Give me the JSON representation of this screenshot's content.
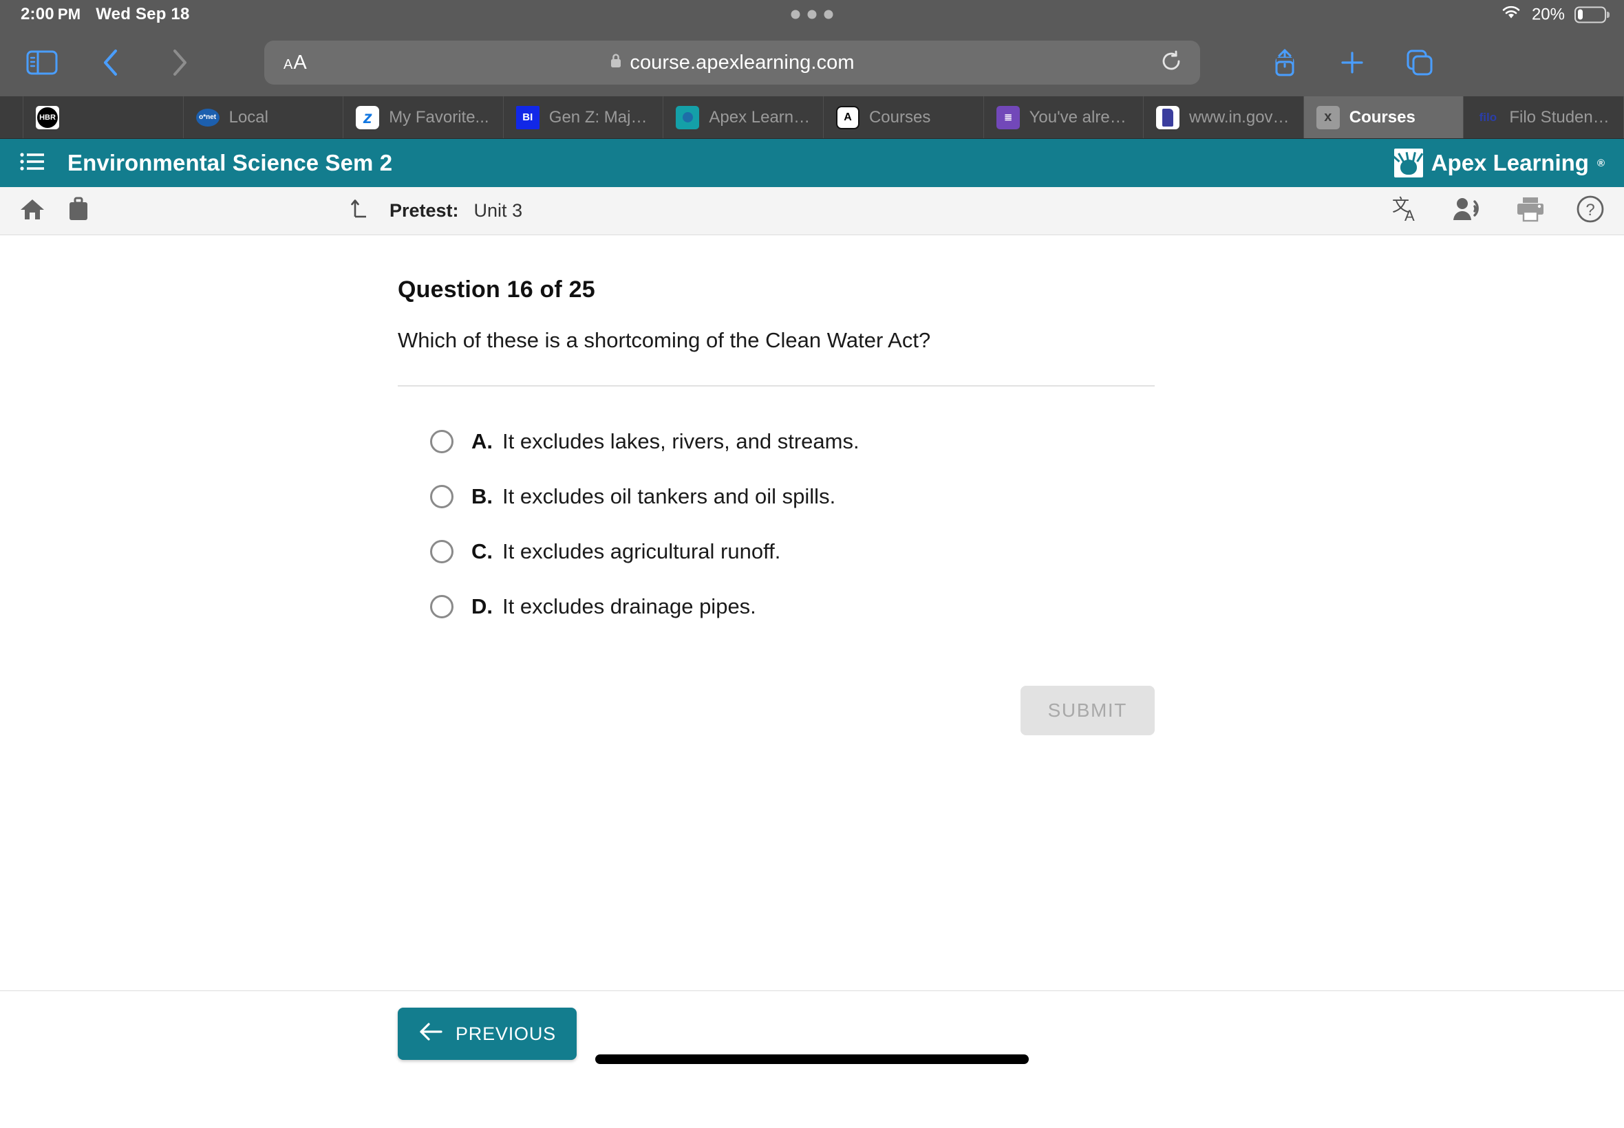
{
  "status_bar": {
    "time": "2:00",
    "meridiem": "PM",
    "date": "Wed Sep 18",
    "battery_percent": "20%",
    "wifi_icon": "wifi-icon",
    "battery_icon": "battery-icon",
    "multitask_icon": "multitasking-dots-icon"
  },
  "browser": {
    "sidebar_icon": "sidebar-toggle-icon",
    "back_icon": "chevron-left-icon",
    "forward_icon": "chevron-right-icon",
    "aa_small": "A",
    "aa_large": "A",
    "lock_icon": "lock-icon",
    "url": "course.apexlearning.com",
    "reload_icon": "reload-icon",
    "share_icon": "share-icon",
    "new_tab_icon": "plus-icon",
    "tabs_overview_icon": "tab-overview-icon",
    "tabs": [
      {
        "label": "",
        "favicon": "hbr-icon",
        "favicon_text": "HBR",
        "active": false,
        "narrow": true
      },
      {
        "label": "",
        "favicon": "hbr-icon",
        "favicon_text": "HBR",
        "active": false,
        "narrow": false
      },
      {
        "label": "Local",
        "favicon": "onet-icon",
        "favicon_text": "o*net",
        "active": false,
        "narrow": false
      },
      {
        "label": "My Favorite...",
        "favicon": "zillow-icon",
        "favicon_text": "z",
        "active": false,
        "narrow": false
      },
      {
        "label": "Gen Z: Major...",
        "favicon": "business-insider-icon",
        "favicon_text": "BI",
        "active": false,
        "narrow": false
      },
      {
        "label": "Apex Learning",
        "favicon": "apex-learning-icon",
        "favicon_text": "",
        "active": false,
        "narrow": false
      },
      {
        "label": "Courses",
        "favicon": "apex-courses-icon",
        "favicon_text": "A",
        "active": false,
        "narrow": false
      },
      {
        "label": "You've alrea...",
        "favicon": "google-forms-icon",
        "favicon_text": "≣",
        "active": false,
        "narrow": false
      },
      {
        "label": "www.in.gov/...",
        "favicon": "in-gov-icon",
        "favicon_text": "",
        "active": false,
        "narrow": false
      },
      {
        "label": "Courses",
        "favicon": "close-icon",
        "favicon_text": "x",
        "active": true,
        "narrow": false
      },
      {
        "label": "Filo Student:...",
        "favicon": "filo-icon",
        "favicon_text": "filo",
        "active": false,
        "narrow": false
      }
    ]
  },
  "app_header": {
    "menu_icon": "list-menu-icon",
    "course_title": "Environmental Science Sem 2",
    "brand_name": "Apex Learning",
    "brand_trademark": "®"
  },
  "sub_toolbar": {
    "home_icon": "home-icon",
    "briefcase_icon": "briefcase-icon",
    "up_level_icon": "up-level-arrow-icon",
    "activity_type": "Pretest:",
    "activity_unit": "Unit 3",
    "translate_icon": "translate-icon",
    "read_aloud_icon": "text-to-speech-icon",
    "print_icon": "print-icon",
    "help_icon": "help-icon"
  },
  "question": {
    "heading": "Question 16 of 25",
    "number": 16,
    "total": 25,
    "prompt": "Which of these is a shortcoming of the Clean Water Act?",
    "options": [
      {
        "letter": "A.",
        "text": "It excludes lakes, rivers, and streams.",
        "selected": false
      },
      {
        "letter": "B.",
        "text": "It excludes oil tankers and oil spills.",
        "selected": false
      },
      {
        "letter": "C.",
        "text": "It excludes agricultural runoff.",
        "selected": false
      },
      {
        "letter": "D.",
        "text": "It excludes drainage pipes.",
        "selected": false
      }
    ],
    "submit_label": "SUBMIT",
    "submit_disabled": true
  },
  "bottom_nav": {
    "previous_label": "PREVIOUS",
    "previous_arrow_icon": "arrow-left-icon",
    "home_indicator": "home-indicator"
  },
  "colors": {
    "brand_teal": "#137d8e",
    "safari_chrome": "#5a5a5a",
    "tabbar": "#3c3c3c",
    "submit_disabled_bg": "#e2e2e2",
    "submit_disabled_text": "#a9a9a9",
    "ios_blue": "#4a9eff"
  }
}
